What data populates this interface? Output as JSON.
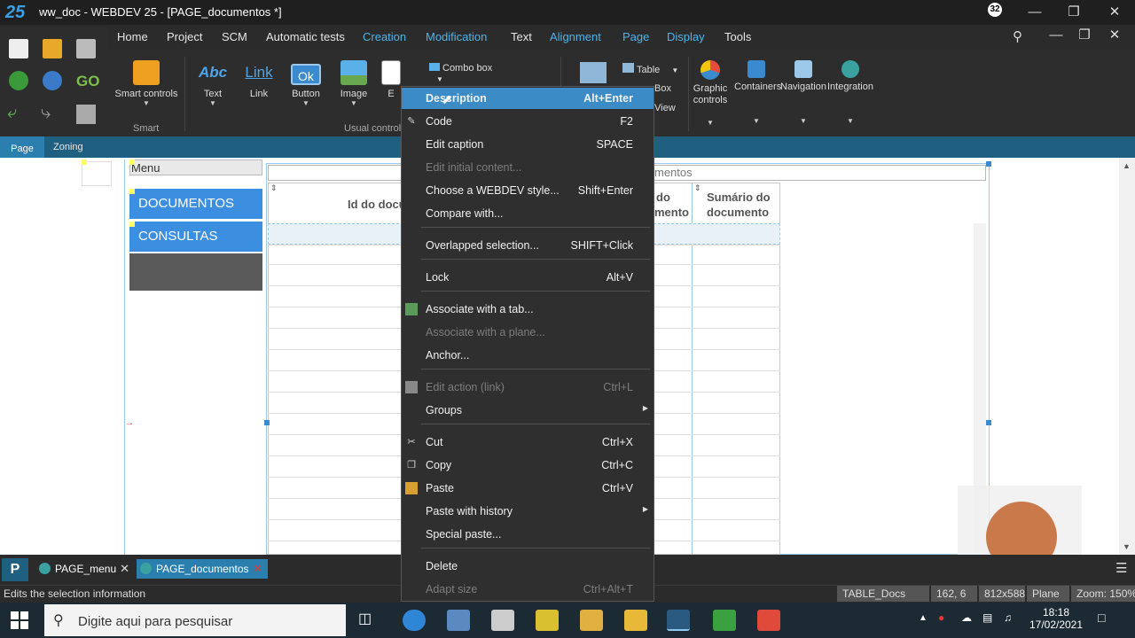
{
  "window": {
    "title": "ww_doc - WEBDEV 25 - [PAGE_documentos *]",
    "logo_text": "25",
    "notification_count": "32"
  },
  "menubar": {
    "items": [
      "Home",
      "Project",
      "SCM",
      "Automatic tests",
      "Creation",
      "Modification",
      "Text",
      "Alignment",
      "Page",
      "Display",
      "Tools"
    ],
    "active": "Creation",
    "accent_color": "#4fb3ea"
  },
  "ribbon": {
    "smart_controls": "Smart controls",
    "smart_group": "Smart",
    "text": "Text",
    "link": "Link",
    "button": "Button",
    "image": "Image",
    "edit_partial": "E",
    "usual_controls_group": "Usual controls",
    "combo_box": "Combo box",
    "table": "Table",
    "box_partial": "Box",
    "view_partial": "View",
    "graphic_controls": "Graphic controls",
    "containers": "Containers",
    "navigation": "Navigation",
    "integration": "Integration",
    "icon_abc": "Abc",
    "icon_link": "Link",
    "icon_ok": "Ok"
  },
  "pagebar": {
    "tab_page": "Page",
    "tab_zoning": "Zoning"
  },
  "editor": {
    "menu_header": "Menu",
    "menu_items": [
      "DOCUMENTOS",
      "CONSULTAS"
    ],
    "table_caption_partial": "mentos",
    "col_id_partial": "Id do docu",
    "col_mid_partial_1": "do",
    "col_mid_partial_2": "mento",
    "col_summary_1": "Sumário do",
    "col_summary_2": "documento"
  },
  "context_menu": {
    "items": [
      {
        "label": "Description",
        "shortcut": "Alt+Enter",
        "highlighted": true
      },
      {
        "label": "Code",
        "shortcut": "F2",
        "icon": "code-icon"
      },
      {
        "label": "Edit caption",
        "shortcut": "SPACE"
      },
      {
        "label": "Edit initial content...",
        "shortcut": "",
        "disabled": true
      },
      {
        "label": "Choose a WEBDEV style...",
        "shortcut": "Shift+Enter"
      },
      {
        "label": "Compare with...",
        "shortcut": ""
      },
      {
        "label": "Overlapped selection...",
        "shortcut": "SHIFT+Click"
      },
      {
        "label": "Lock",
        "shortcut": "Alt+V"
      },
      {
        "label": "Associate with a tab...",
        "shortcut": "",
        "icon": "tab-icon"
      },
      {
        "label": "Associate with a plane...",
        "shortcut": "",
        "disabled": true
      },
      {
        "label": "Anchor...",
        "shortcut": ""
      },
      {
        "label": "Edit action (link)",
        "shortcut": "Ctrl+L",
        "disabled": true,
        "icon": "action-icon"
      },
      {
        "label": "Groups",
        "shortcut": "",
        "submenu": true
      },
      {
        "label": "Cut",
        "shortcut": "Ctrl+X",
        "icon": "scissors-icon"
      },
      {
        "label": "Copy",
        "shortcut": "Ctrl+C",
        "icon": "copy-icon"
      },
      {
        "label": "Paste",
        "shortcut": "Ctrl+V",
        "icon": "paste-icon"
      },
      {
        "label": "Paste with history",
        "shortcut": "",
        "submenu": true
      },
      {
        "label": "Special paste...",
        "shortcut": ""
      },
      {
        "label": "Delete",
        "shortcut": ""
      },
      {
        "label": "Adapt size",
        "shortcut": "Ctrl+Alt+T",
        "disabled": true
      }
    ],
    "highlight_color": "#3b8cc6"
  },
  "doc_tabs": {
    "logo": "P",
    "tabs": [
      "PAGE_menu",
      "PAGE_documentos"
    ],
    "active": "PAGE_documentos",
    "close_glyph": "✕"
  },
  "statusbar": {
    "message": "Edits the selection information",
    "control_name": "TABLE_Docs",
    "position": "162, 6",
    "size": "812x588",
    "plane": "Plane",
    "zoom": "Zoom: 150%"
  },
  "taskbar": {
    "search_placeholder": "Digite aqui para pesquisar",
    "time": "18:18",
    "date": "17/02/2021"
  }
}
